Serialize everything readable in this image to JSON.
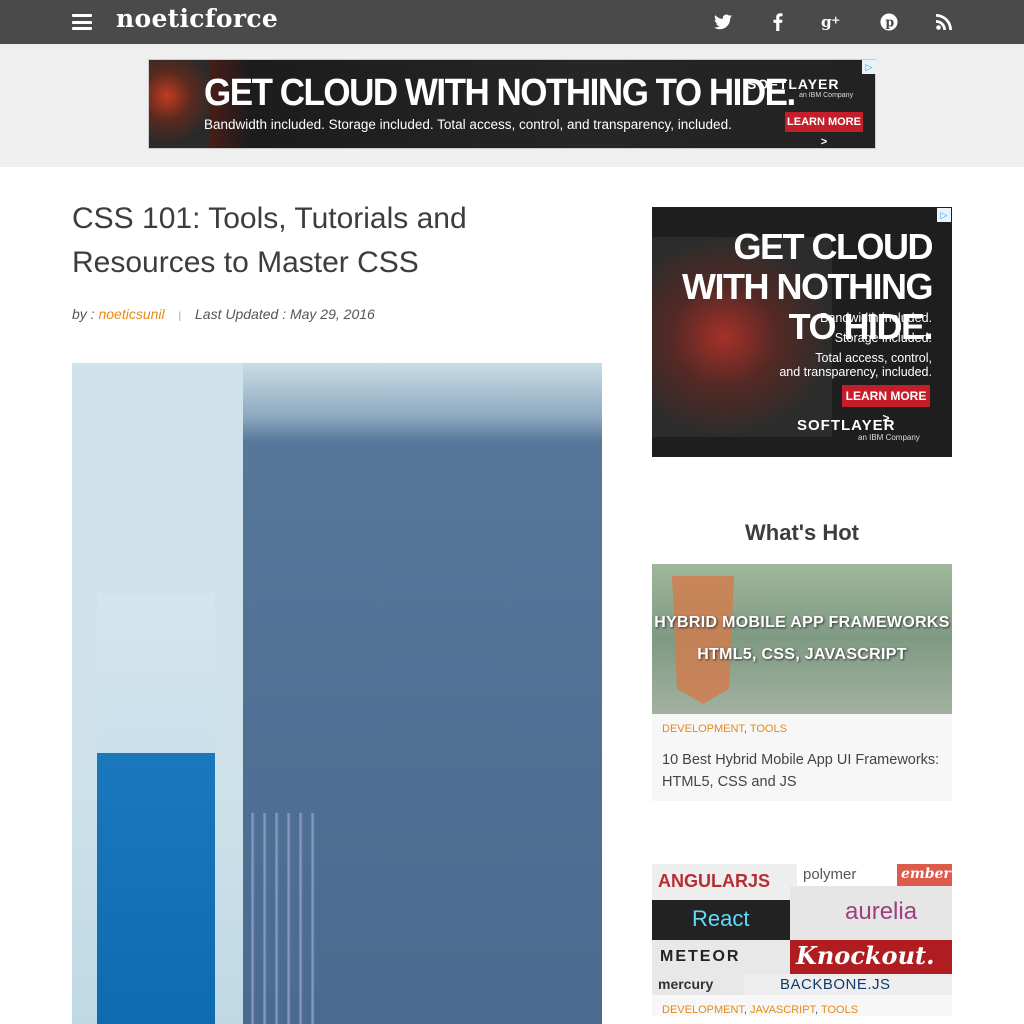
{
  "nav": {
    "logo": "noeticforce",
    "social": [
      {
        "name": "twitter-icon",
        "glyph": "🐦"
      },
      {
        "name": "facebook-icon",
        "glyph": "f"
      },
      {
        "name": "google-plus-icon",
        "glyph": "g+"
      },
      {
        "name": "pinterest-icon",
        "glyph": "℗"
      },
      {
        "name": "rss-icon",
        "glyph": "◥"
      }
    ]
  },
  "top_ad": {
    "headline": "GET CLOUD WITH NOTHING TO HIDE.",
    "subline": "Bandwidth included. Storage included. Total access, control, and transparency, included.",
    "brand": "SOFTLAYER",
    "brand_sub": "an IBM Company",
    "cta": "LEARN MORE >"
  },
  "article": {
    "title": "CSS 101: Tools, Tutorials and Resources to Master CSS",
    "by_label": "by :",
    "author": "noeticsunil",
    "separator": "|",
    "updated_label": "Last Updated : May 29, 2016"
  },
  "side_ad": {
    "headline": "GET CLOUD WITH NOTHING TO HIDE.",
    "line1": "Bandwidth included.",
    "line2": "Storage included.",
    "line3": "Total access, control,",
    "line4": "and transparency, included.",
    "cta": "LEARN MORE >",
    "brand": "SOFTLAYER",
    "brand_sub": "an IBM Company"
  },
  "sidebar": {
    "heading": "What's Hot",
    "posts": [
      {
        "thumb_line1": "HYBRID MOBILE APP FRAMEWORKS",
        "thumb_line2": "HTML5, CSS, JAVASCRIPT",
        "cat1": "DEVELOPMENT",
        "cat2": "TOOLS",
        "title": "10 Best Hybrid Mobile App UI Frameworks: HTML5, CSS and JS"
      },
      {
        "logos": [
          "ANGULARJS",
          "polymer",
          "ember",
          "React",
          "aurelia",
          "METEOR",
          "Knockout.",
          "mercury",
          "BACKBONE.JS"
        ],
        "cat1": "DEVELOPMENT",
        "cat2": "JAVASCRIPT",
        "cat3": "TOOLS"
      }
    ]
  },
  "colors": {
    "nav_bg": "#4a4a4a",
    "accent": "#e48a16",
    "ad_red": "#c41e2b"
  }
}
